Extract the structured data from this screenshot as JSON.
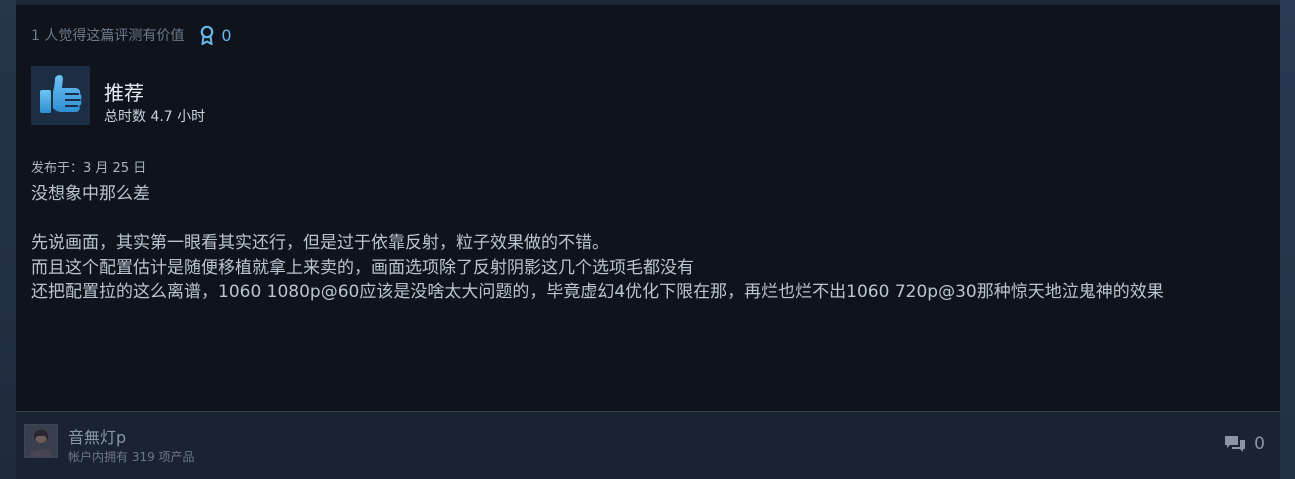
{
  "review": {
    "helpful_text": "1 人觉得这篇评测有价值",
    "award_count": "0",
    "recommendation": "推荐",
    "hours": "总时数 4.7 小时",
    "posted": "发布于：3 月 25 日",
    "paragraphs": [
      "没想象中那么差",
      "",
      "先说画面，其实第一眼看其实还行，但是过于依靠反射，粒子效果做的不错。",
      "而且这个配置估计是随便移植就拿上来卖的，画面选项除了反射阴影这几个选项毛都没有",
      "还把配置拉的这么离谱，1060 1080p@60应该是没啥太大问题的，毕竟虚幻4优化下限在那，再烂也烂不出1060 720p@30那种惊天地泣鬼神的效果"
    ]
  },
  "author": {
    "name": "音無灯p",
    "products": "帐户内拥有 319 项产品"
  },
  "comments": {
    "count": "0"
  },
  "colors": {
    "accent": "#6ab7ea",
    "card_bg": "#0f141c",
    "footer_bg": "#1a2331"
  }
}
